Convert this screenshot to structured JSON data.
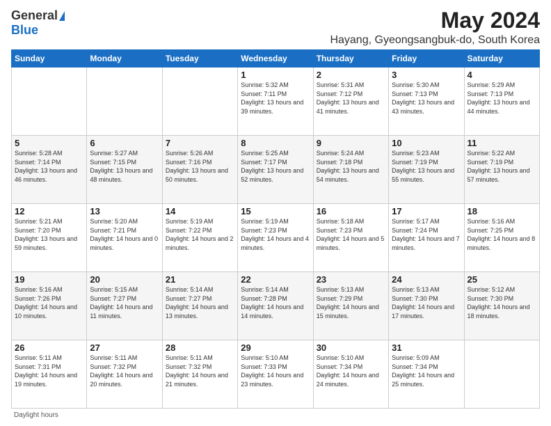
{
  "header": {
    "logo_general": "General",
    "logo_blue": "Blue",
    "month_title": "May 2024",
    "location": "Hayang, Gyeongsangbuk-do, South Korea"
  },
  "weekdays": [
    "Sunday",
    "Monday",
    "Tuesday",
    "Wednesday",
    "Thursday",
    "Friday",
    "Saturday"
  ],
  "footer": {
    "daylight_label": "Daylight hours"
  },
  "weeks": [
    [
      {
        "day": "",
        "info": ""
      },
      {
        "day": "",
        "info": ""
      },
      {
        "day": "",
        "info": ""
      },
      {
        "day": "1",
        "info": "Sunrise: 5:32 AM\nSunset: 7:11 PM\nDaylight: 13 hours\nand 39 minutes."
      },
      {
        "day": "2",
        "info": "Sunrise: 5:31 AM\nSunset: 7:12 PM\nDaylight: 13 hours\nand 41 minutes."
      },
      {
        "day": "3",
        "info": "Sunrise: 5:30 AM\nSunset: 7:13 PM\nDaylight: 13 hours\nand 43 minutes."
      },
      {
        "day": "4",
        "info": "Sunrise: 5:29 AM\nSunset: 7:13 PM\nDaylight: 13 hours\nand 44 minutes."
      }
    ],
    [
      {
        "day": "5",
        "info": "Sunrise: 5:28 AM\nSunset: 7:14 PM\nDaylight: 13 hours\nand 46 minutes."
      },
      {
        "day": "6",
        "info": "Sunrise: 5:27 AM\nSunset: 7:15 PM\nDaylight: 13 hours\nand 48 minutes."
      },
      {
        "day": "7",
        "info": "Sunrise: 5:26 AM\nSunset: 7:16 PM\nDaylight: 13 hours\nand 50 minutes."
      },
      {
        "day": "8",
        "info": "Sunrise: 5:25 AM\nSunset: 7:17 PM\nDaylight: 13 hours\nand 52 minutes."
      },
      {
        "day": "9",
        "info": "Sunrise: 5:24 AM\nSunset: 7:18 PM\nDaylight: 13 hours\nand 54 minutes."
      },
      {
        "day": "10",
        "info": "Sunrise: 5:23 AM\nSunset: 7:19 PM\nDaylight: 13 hours\nand 55 minutes."
      },
      {
        "day": "11",
        "info": "Sunrise: 5:22 AM\nSunset: 7:19 PM\nDaylight: 13 hours\nand 57 minutes."
      }
    ],
    [
      {
        "day": "12",
        "info": "Sunrise: 5:21 AM\nSunset: 7:20 PM\nDaylight: 13 hours\nand 59 minutes."
      },
      {
        "day": "13",
        "info": "Sunrise: 5:20 AM\nSunset: 7:21 PM\nDaylight: 14 hours\nand 0 minutes."
      },
      {
        "day": "14",
        "info": "Sunrise: 5:19 AM\nSunset: 7:22 PM\nDaylight: 14 hours\nand 2 minutes."
      },
      {
        "day": "15",
        "info": "Sunrise: 5:19 AM\nSunset: 7:23 PM\nDaylight: 14 hours\nand 4 minutes."
      },
      {
        "day": "16",
        "info": "Sunrise: 5:18 AM\nSunset: 7:23 PM\nDaylight: 14 hours\nand 5 minutes."
      },
      {
        "day": "17",
        "info": "Sunrise: 5:17 AM\nSunset: 7:24 PM\nDaylight: 14 hours\nand 7 minutes."
      },
      {
        "day": "18",
        "info": "Sunrise: 5:16 AM\nSunset: 7:25 PM\nDaylight: 14 hours\nand 8 minutes."
      }
    ],
    [
      {
        "day": "19",
        "info": "Sunrise: 5:16 AM\nSunset: 7:26 PM\nDaylight: 14 hours\nand 10 minutes."
      },
      {
        "day": "20",
        "info": "Sunrise: 5:15 AM\nSunset: 7:27 PM\nDaylight: 14 hours\nand 11 minutes."
      },
      {
        "day": "21",
        "info": "Sunrise: 5:14 AM\nSunset: 7:27 PM\nDaylight: 14 hours\nand 13 minutes."
      },
      {
        "day": "22",
        "info": "Sunrise: 5:14 AM\nSunset: 7:28 PM\nDaylight: 14 hours\nand 14 minutes."
      },
      {
        "day": "23",
        "info": "Sunrise: 5:13 AM\nSunset: 7:29 PM\nDaylight: 14 hours\nand 15 minutes."
      },
      {
        "day": "24",
        "info": "Sunrise: 5:13 AM\nSunset: 7:30 PM\nDaylight: 14 hours\nand 17 minutes."
      },
      {
        "day": "25",
        "info": "Sunrise: 5:12 AM\nSunset: 7:30 PM\nDaylight: 14 hours\nand 18 minutes."
      }
    ],
    [
      {
        "day": "26",
        "info": "Sunrise: 5:11 AM\nSunset: 7:31 PM\nDaylight: 14 hours\nand 19 minutes."
      },
      {
        "day": "27",
        "info": "Sunrise: 5:11 AM\nSunset: 7:32 PM\nDaylight: 14 hours\nand 20 minutes."
      },
      {
        "day": "28",
        "info": "Sunrise: 5:11 AM\nSunset: 7:32 PM\nDaylight: 14 hours\nand 21 minutes."
      },
      {
        "day": "29",
        "info": "Sunrise: 5:10 AM\nSunset: 7:33 PM\nDaylight: 14 hours\nand 23 minutes."
      },
      {
        "day": "30",
        "info": "Sunrise: 5:10 AM\nSunset: 7:34 PM\nDaylight: 14 hours\nand 24 minutes."
      },
      {
        "day": "31",
        "info": "Sunrise: 5:09 AM\nSunset: 7:34 PM\nDaylight: 14 hours\nand 25 minutes."
      },
      {
        "day": "",
        "info": ""
      }
    ]
  ]
}
